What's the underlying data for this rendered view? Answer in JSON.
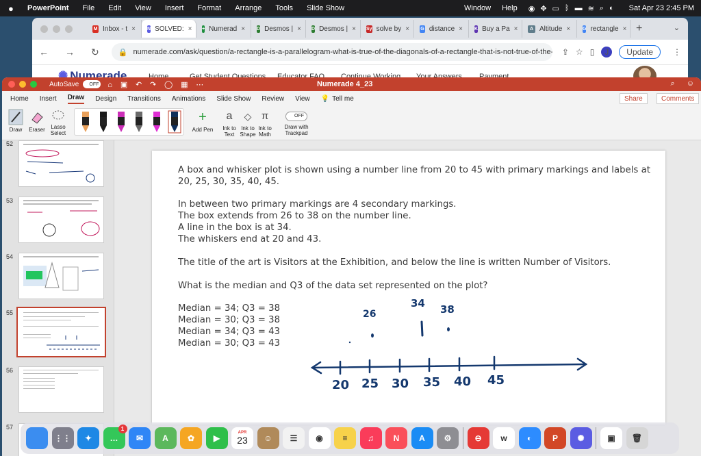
{
  "menubar": {
    "app": "PowerPoint",
    "items": [
      "File",
      "Edit",
      "View",
      "Insert",
      "Format",
      "Arrange",
      "Tools",
      "Slide Show"
    ],
    "right_items": [
      "Window",
      "Help"
    ],
    "datetime": "Sat Apr 23  2:45 PM"
  },
  "chrome": {
    "tabs": [
      {
        "label": "Inbox - t",
        "color": "#d93025",
        "glyph": "M",
        "active": false
      },
      {
        "label": "SOLVED:",
        "color": "#5b5ce2",
        "glyph": "N",
        "active": true
      },
      {
        "label": "Numerad",
        "color": "#1e8e3e",
        "glyph": "+",
        "active": false
      },
      {
        "label": "Desmos |",
        "color": "#2e7d32",
        "glyph": "D",
        "active": false
      },
      {
        "label": "Desmos |",
        "color": "#2e7d32",
        "glyph": "D",
        "active": false
      },
      {
        "label": "solve by",
        "color": "#c62828",
        "glyph": "Sy",
        "active": false
      },
      {
        "label": "distance",
        "color": "#4285f4",
        "glyph": "G",
        "active": false
      },
      {
        "label": "Buy a Pa",
        "color": "#5e35b1",
        "glyph": "K",
        "active": false
      },
      {
        "label": "Altitude",
        "color": "#607d8b",
        "glyph": "A",
        "active": false
      },
      {
        "label": "rectangle",
        "color": "#4285f4",
        "glyph": "G",
        "active": false
      }
    ],
    "url": "numerade.com/ask/question/a-rectangle-is-a-parallelogram-what-is-true-of-the-diagonals-of-a-rectangle-that-is-not-true-of-the-diagonals-of-a-parallel...",
    "profile_initial": "J",
    "update_label": "Update"
  },
  "site": {
    "logo": "Numerade",
    "links": [
      "Home",
      "Get Student Questions",
      "Educator FAQ",
      "Continue Working",
      "Your Answers",
      "Payment"
    ]
  },
  "ppt": {
    "autosave": "AutoSave",
    "autosave_state": "OFF",
    "doc_title": "Numerade 4_23",
    "ribbon_tabs": [
      "Home",
      "Insert",
      "Draw",
      "Design",
      "Transitions",
      "Animations",
      "Slide Show",
      "Review",
      "View"
    ],
    "active_tab": "Draw",
    "tell_me": "Tell me",
    "share": "Share",
    "comments": "Comments",
    "tools": {
      "draw": "Draw",
      "eraser": "Eraser",
      "lasso_1": "Lasso",
      "lasso_2": "Select",
      "add_pen": "Add Pen",
      "ink_text_1": "Ink to",
      "ink_text_2": "Text",
      "ink_shape_1": "Ink to",
      "ink_shape_2": "Shape",
      "ink_math_1": "Ink to",
      "ink_math_2": "Math",
      "trackpad_state": "OFF",
      "trackpad_1": "Draw with",
      "trackpad_2": "Trackpad"
    },
    "pen_colors": [
      "#e8a05a",
      "#1a1a1a",
      "#cc2fb8",
      "#6a6a6a",
      "#e02fd4",
      "#0f2f5a"
    ],
    "slide_numbers": [
      "52",
      "53",
      "54",
      "55",
      "56",
      "57"
    ],
    "selected_slide": "55"
  },
  "slide": {
    "para1": "A box and whisker plot is shown using a number line from 20 to 45 with primary markings and labels at 20, 25, 30, 35, 40, 45.",
    "para2_lines": [
      "In between two primary markings are 4 secondary markings.",
      "The box extends from 26 to 38 on the number line.",
      "A line in the box is at 34.",
      "The whiskers end at 20 and 43."
    ],
    "para3": "The title of the art is Visitors at the Exhibition, and below the line is written Number of Visitors.",
    "question": "What is the median and Q3 of the data set represented on the plot?",
    "options": [
      "Median = 34; Q3 = 38",
      "Median = 30; Q3 = 38",
      "Median = 34; Q3 = 43",
      "Median = 30; Q3 = 43"
    ],
    "ink": {
      "tick_labels": [
        "20",
        "25",
        "30",
        "35",
        "40",
        "45"
      ],
      "marked_values": [
        "26",
        "34",
        "38"
      ]
    }
  },
  "dock": {
    "apps": [
      {
        "name": "finder",
        "color": "#3b8df0",
        "glyph": ""
      },
      {
        "name": "launchpad",
        "color": "#7f7f8c",
        "glyph": "⋮⋮"
      },
      {
        "name": "safari",
        "color": "#1e88e5",
        "glyph": "✦"
      },
      {
        "name": "messages",
        "color": "#34c759",
        "glyph": "…",
        "badge": "1"
      },
      {
        "name": "mail",
        "color": "#2f86f6",
        "glyph": "✉"
      },
      {
        "name": "maps",
        "color": "#5cb85c",
        "glyph": "A"
      },
      {
        "name": "photos",
        "color": "#f5a623",
        "glyph": "✿"
      },
      {
        "name": "facetime",
        "color": "#2fbf4a",
        "glyph": "▶"
      },
      {
        "name": "calendar",
        "color": "#ffffff",
        "glyph": "23"
      },
      {
        "name": "contacts",
        "color": "#b08a5a",
        "glyph": "☺"
      },
      {
        "name": "reminders",
        "color": "#f2f2f2",
        "glyph": "☰"
      },
      {
        "name": "chrome",
        "color": "#ffffff",
        "glyph": "◉"
      },
      {
        "name": "notes",
        "color": "#f7d24a",
        "glyph": "≡"
      },
      {
        "name": "music",
        "color": "#fa3c5a",
        "glyph": "♫"
      },
      {
        "name": "news",
        "color": "#fa4f5a",
        "glyph": "N"
      },
      {
        "name": "app-store",
        "color": "#1a8cf5",
        "glyph": "A"
      },
      {
        "name": "system-preferences",
        "color": "#8e8e93",
        "glyph": "⚙"
      },
      {
        "name": "no-entry",
        "color": "#e53935",
        "glyph": "⊖"
      },
      {
        "name": "webex",
        "color": "#ffffff",
        "glyph": "w"
      },
      {
        "name": "zoom-app",
        "color": "#2d8cff",
        "glyph": "◐"
      },
      {
        "name": "powerpoint",
        "color": "#d24726",
        "glyph": "P"
      },
      {
        "name": "numerade-app",
        "color": "#5b5ce2",
        "glyph": "✺"
      },
      {
        "name": "preview",
        "color": "#ffffff",
        "glyph": "▣"
      },
      {
        "name": "trash",
        "color": "#d6d6d6",
        "glyph": "🗑"
      }
    ],
    "calendar_month": "APR"
  }
}
